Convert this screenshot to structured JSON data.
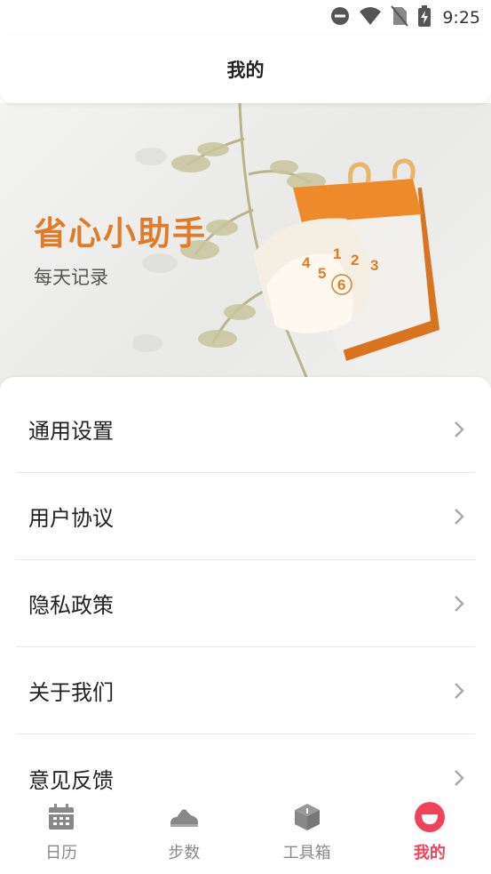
{
  "status_bar": {
    "time": "9:25"
  },
  "header": {
    "title": "我的"
  },
  "banner": {
    "headline": "省心小助手",
    "subline": "每天记录",
    "calendar_digits": [
      "1",
      "2",
      "3",
      "4",
      "5",
      "6"
    ]
  },
  "menu": [
    {
      "label": "通用设置"
    },
    {
      "label": "用户协议"
    },
    {
      "label": "隐私政策"
    },
    {
      "label": "关于我们"
    },
    {
      "label": "意见反馈"
    }
  ],
  "tabbar": {
    "tabs": [
      {
        "label": "日历",
        "icon": "calendar-icon"
      },
      {
        "label": "步数",
        "icon": "shoe-icon"
      },
      {
        "label": "工具箱",
        "icon": "toolbox-icon"
      },
      {
        "label": "我的",
        "icon": "profile-icon"
      }
    ],
    "active_color": "#f0425a",
    "inactive_color": "#888888"
  },
  "colors": {
    "accent": "#e07b2a"
  }
}
